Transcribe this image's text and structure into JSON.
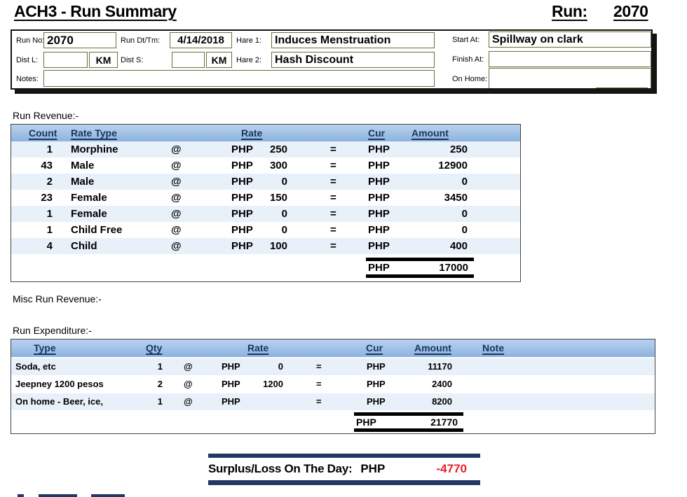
{
  "header": {
    "title": "ACH3 - Run Summary",
    "run_label": "Run:",
    "run_number": "2070"
  },
  "run_info": {
    "run_no": {
      "label": "Run No:",
      "value": "2070"
    },
    "run_dt": {
      "label": "Run Dt/Tm:",
      "value": "4/14/2018"
    },
    "hare1": {
      "label": "Hare 1:",
      "value": "Induces Menstruation"
    },
    "hare2": {
      "label": "Hare 2:",
      "value": "Hash Discount"
    },
    "start_at": {
      "label": "Start At:",
      "value": "Spillway on clark"
    },
    "finish_at": {
      "label": "Finish At:",
      "value": ""
    },
    "dist_l": {
      "label": "Dist L:",
      "value": "",
      "unit": "KM"
    },
    "dist_s": {
      "label": "Dist S:",
      "value": "",
      "unit": "KM"
    },
    "notes": {
      "label": "Notes:",
      "value": ""
    },
    "on_home": {
      "label": "On Home:",
      "value": ""
    }
  },
  "sections": {
    "run_revenue": "Run Revenue:-",
    "misc_run_revenue": "Misc Run Revenue:-",
    "run_expenditure": "Run Expenditure:-"
  },
  "symbols": {
    "at": "@",
    "eq": "="
  },
  "revenue_table": {
    "headers": {
      "count": "Count",
      "rate_type": "Rate Type",
      "rate": "Rate",
      "cur": "Cur",
      "amount": "Amount"
    },
    "rows": [
      {
        "count": "1",
        "rate_type": "Morphine",
        "cur": "PHP",
        "rate": "250",
        "amount": "250"
      },
      {
        "count": "43",
        "rate_type": "Male",
        "cur": "PHP",
        "rate": "300",
        "amount": "12900"
      },
      {
        "count": "2",
        "rate_type": "Male",
        "cur": "PHP",
        "rate": "0",
        "amount": "0"
      },
      {
        "count": "23",
        "rate_type": "Female",
        "cur": "PHP",
        "rate": "150",
        "amount": "3450"
      },
      {
        "count": "1",
        "rate_type": "Female",
        "cur": "PHP",
        "rate": "0",
        "amount": "0"
      },
      {
        "count": "1",
        "rate_type": "Child Free",
        "cur": "PHP",
        "rate": "0",
        "amount": "0"
      },
      {
        "count": "4",
        "rate_type": "Child",
        "cur": "PHP",
        "rate": "100",
        "amount": "400"
      }
    ],
    "total": {
      "cur": "PHP",
      "amount": "17000"
    }
  },
  "expenditure_table": {
    "headers": {
      "type": "Type",
      "qty": "Qty",
      "rate": "Rate",
      "cur": "Cur",
      "amount": "Amount",
      "note": "Note"
    },
    "rows": [
      {
        "type": "Soda, etc",
        "qty": "1",
        "cur": "PHP",
        "rate": "0",
        "amount": "11170",
        "note": ""
      },
      {
        "type": "Jeepney 1200 pesos",
        "qty": "2",
        "cur": "PHP",
        "rate": "1200",
        "amount": "2400",
        "note": ""
      },
      {
        "type": "On home - Beer, ice,",
        "qty": "1",
        "cur": "PHP",
        "rate": "",
        "amount": "8200",
        "note": ""
      }
    ],
    "total": {
      "cur": "PHP",
      "amount": "21770"
    }
  },
  "surplus": {
    "label": "Surplus/Loss On The Day:",
    "cur": "PHP",
    "value": "-4770"
  },
  "footer": {
    "clipped_text_fragment": true
  },
  "colors": {
    "table_header_blue": "#9dc3e6",
    "row_tint_blue": "#e8f1f9",
    "accent_navy": "#1f3864",
    "negative_red": "#e5202a",
    "field_border_olive": "#6b6e3b"
  }
}
